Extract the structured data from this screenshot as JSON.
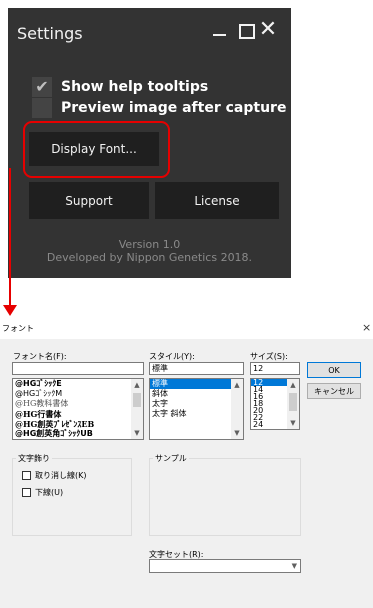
{
  "settings_window": {
    "title": "Settings",
    "minimize_glyph": "",
    "maximize_glyph": "",
    "close_glyph": "✕",
    "checkboxes": [
      {
        "label": "Show help tooltips",
        "checked": true
      },
      {
        "label": "Preview image after capture",
        "checked": false
      }
    ],
    "display_font_button": "Display Font...",
    "support_button": "Support",
    "license_button": "License",
    "version": "Version 1.0",
    "developer": "Developed by Nippon Genetics 2018.",
    "highlight_color": "#e60000"
  },
  "font_dialog": {
    "title": "フォント",
    "close_glyph": "×",
    "font_name_label": "フォント名(F):",
    "font_name_value": "",
    "font_list": [
      "@HGｺﾞｼｯｸE",
      "@HGｺﾞｼｯｸM",
      "@HG教科書体",
      "@HG行書体",
      "@HG創英ﾌﾟﾚｾﾞﾝｽEB",
      "@HG創英角ｺﾞｼｯｸUB"
    ],
    "style_label": "スタイル(Y):",
    "style_value": "標準",
    "style_list": [
      "標準",
      "斜体",
      "太字",
      "太字 斜体"
    ],
    "style_selected": "標準",
    "size_label": "サイズ(S):",
    "size_value": "12",
    "size_list": [
      "12",
      "14",
      "16",
      "18",
      "20",
      "22",
      "24"
    ],
    "size_selected": "12",
    "ok_button": "OK",
    "cancel_button": "キャンセル",
    "effects_label": "文字飾り",
    "strikeout_label": "取り消し線(K)",
    "underline_label": "下線(U)",
    "sample_label": "サンプル",
    "charset_label": "文字セット(R):",
    "charset_value": "",
    "accent_color": "#0078d7"
  }
}
